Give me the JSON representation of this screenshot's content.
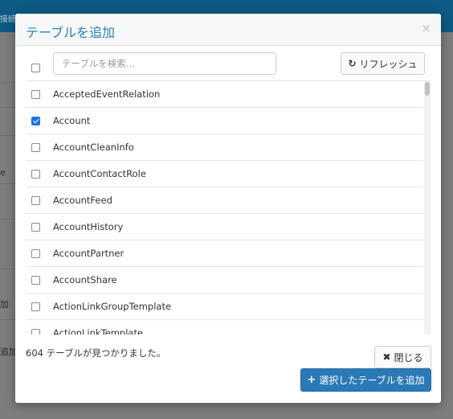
{
  "background": {
    "topbar_label": "接続",
    "fragments": [
      "e",
      "加",
      "追加"
    ]
  },
  "modal": {
    "title": "テーブルを追加",
    "close_glyph": "×"
  },
  "search": {
    "placeholder": "テーブルを検索...",
    "value": ""
  },
  "refresh_button": {
    "icon": "refresh-icon",
    "icon_glyph": "↻",
    "label": "リフレッシュ"
  },
  "tables": [
    {
      "name": "AcceptedEventRelation",
      "checked": false
    },
    {
      "name": "Account",
      "checked": true
    },
    {
      "name": "AccountCleanInfo",
      "checked": false
    },
    {
      "name": "AccountContactRole",
      "checked": false
    },
    {
      "name": "AccountFeed",
      "checked": false
    },
    {
      "name": "AccountHistory",
      "checked": false
    },
    {
      "name": "AccountPartner",
      "checked": false
    },
    {
      "name": "AccountShare",
      "checked": false
    },
    {
      "name": "ActionLinkGroupTemplate",
      "checked": false
    },
    {
      "name": "ActionLinkTemplate",
      "checked": false
    }
  ],
  "footer": {
    "count_text": "604 テーブルが見つかりました。",
    "close_button": {
      "icon": "close-icon",
      "icon_glyph": "✖",
      "label": "閉じる"
    },
    "add_button": {
      "icon": "plus-icon",
      "icon_glyph": "+",
      "label": "選択したテーブルを追加"
    }
  },
  "colors": {
    "accent": "#2a7ab8",
    "title": "#2b7fb8",
    "checkbox_checked": "#1a73e8"
  }
}
